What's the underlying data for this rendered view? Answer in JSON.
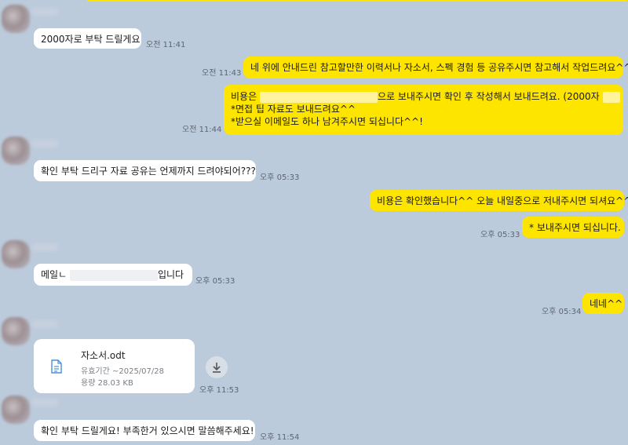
{
  "messages": {
    "m1": {
      "text": "2000자로 부탁 드릴게요",
      "time": "오전 11:41"
    },
    "m2": {
      "text": "네 위에 안내드린 참고할만한 이력서나 자소서, 스펙 경험 등 공유주시면 참고해서 작업드려요^^",
      "time": "오전 11:43"
    },
    "m3": {
      "line1_prefix": "비용은",
      "line1_suffix": "으로 보내주시면 확인 후 작성해서 보내드려요. (2000자",
      "line2": "*면접 팁 자료도 보내드려요^^",
      "line3": "*받으실 이메일도 하나 남겨주시면 되십니다^^!",
      "time": "오전 11:44"
    },
    "m4": {
      "text": "확인 부탁 드리구 자료 공유는 언제까지 드려야되어???",
      "time": "오후 05:33"
    },
    "m5": {
      "text": "비용은 확인했습니다^^ 오늘 내일중으로 저내주시면 되셔요^^",
      "time": ""
    },
    "m6": {
      "text": "* 보내주시면 되십니다.",
      "time": "오후 05:33"
    },
    "m7": {
      "prefix": "메일ㄴ",
      "suffix": "입니다",
      "time": "오후 05:33"
    },
    "m8": {
      "text": "네네^^",
      "time": "오후 05:34"
    },
    "m9": {
      "file_name": "자소서.odt",
      "expiry": "유효기간 ~2025/07/28",
      "size": "용량 28.03 KB",
      "time": "오후 11:53"
    },
    "m10": {
      "text": "확인 부탁 드릴게요! 부족한거 있으시면 말씀해주세요!",
      "time": "오후 11:54"
    }
  },
  "colors": {
    "background": "#bccbdc",
    "outgoing": "#fee500",
    "incoming": "#ffffff"
  },
  "icons": {
    "file": "document-icon",
    "download": "download-icon"
  }
}
